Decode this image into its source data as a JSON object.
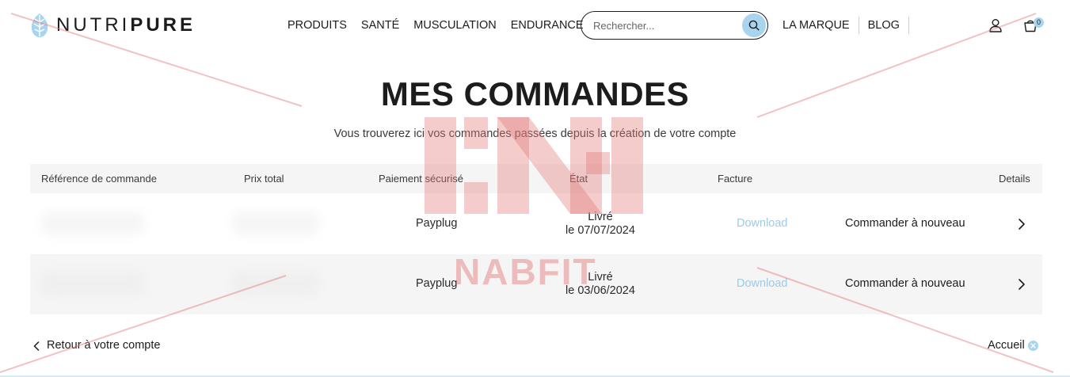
{
  "header": {
    "logo": {
      "part1": "NUTRI",
      "part2": "PURE"
    },
    "nav": [
      "PRODUITS",
      "SANTÉ",
      "MUSCULATION",
      "ENDURANCE"
    ],
    "search": {
      "placeholder": "Rechercher..."
    },
    "nav_right": [
      "LA MARQUE",
      "BLOG"
    ],
    "cart_count": "0"
  },
  "page": {
    "title": "MES COMMANDES",
    "subtitle": "Vous trouverez ici vos commandes passées depuis la création de votre compte"
  },
  "table": {
    "headers": [
      "Référence de commande",
      "Prix total",
      "Paiement sécurisé",
      "État",
      "Facture",
      "Details"
    ],
    "rows": [
      {
        "payment": "Payplug",
        "state_line1": "Livré",
        "state_line2": "le 07/07/2024",
        "invoice": "Download",
        "reorder": "Commander à nouveau"
      },
      {
        "payment": "Payplug",
        "state_line1": "Livré",
        "state_line2": "le 03/06/2024",
        "invoice": "Download",
        "reorder": "Commander à nouveau"
      }
    ]
  },
  "footer": {
    "back_label": "Retour à votre compte",
    "home_label": "Accueil"
  },
  "watermark": {
    "text": "NABFIT"
  },
  "colors": {
    "accent": "#a8d4ee",
    "link": "#9dcbe6",
    "text": "#1c1c1c",
    "row_alt": "#f5f5f5",
    "watermark": "#e27878"
  },
  "icons": [
    "leaf-logo-icon",
    "search-icon",
    "user-icon",
    "cart-icon",
    "chevron-right-icon",
    "chevron-left-icon",
    "close-icon"
  ]
}
